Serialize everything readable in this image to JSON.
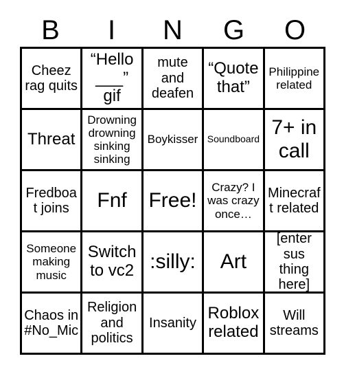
{
  "header": {
    "letters": [
      "B",
      "I",
      "N",
      "G",
      "O"
    ]
  },
  "grid": {
    "rows": 5,
    "cols": 5,
    "border_color": "#000000",
    "background_color": "#ffffff",
    "text_color": "#000000",
    "cells": [
      {
        "text": "Cheez rag quits",
        "size": "sz-m"
      },
      {
        "text": "“Hello ___” gif",
        "size": "sz-l"
      },
      {
        "text": "mute and deafen",
        "size": "sz-m"
      },
      {
        "text": "“Quote that”",
        "size": "sz-l"
      },
      {
        "text": "Philippine related",
        "size": "sz-s"
      },
      {
        "text": "Threat",
        "size": "sz-l"
      },
      {
        "text": "Drowning drowning sinking sinking",
        "size": "sz-s"
      },
      {
        "text": "Boykisser",
        "size": "sz-s"
      },
      {
        "text": "Soundboard",
        "size": "sz-xs"
      },
      {
        "text": "7+ in call",
        "size": "sz-xl"
      },
      {
        "text": "Fredboat joins",
        "size": "sz-m"
      },
      {
        "text": "Fnf",
        "size": "sz-xl"
      },
      {
        "text": "Free!",
        "size": "sz-xl"
      },
      {
        "text": "Crazy? I was crazy once…",
        "size": "sz-s"
      },
      {
        "text": "Minecraft related",
        "size": "sz-m"
      },
      {
        "text": "Someone making music",
        "size": "sz-s"
      },
      {
        "text": "Switch to vc2",
        "size": "sz-l"
      },
      {
        "text": ":silly:",
        "size": "sz-xl"
      },
      {
        "text": "Art",
        "size": "sz-xl"
      },
      {
        "text": "[enter sus thing here]",
        "size": "sz-m"
      },
      {
        "text": "Chaos in #No_Mic",
        "size": "sz-m"
      },
      {
        "text": "Religion and politics",
        "size": "sz-m"
      },
      {
        "text": "Insanity",
        "size": "sz-m"
      },
      {
        "text": "Roblox related",
        "size": "sz-l"
      },
      {
        "text": "Will streams",
        "size": "sz-m"
      }
    ]
  }
}
